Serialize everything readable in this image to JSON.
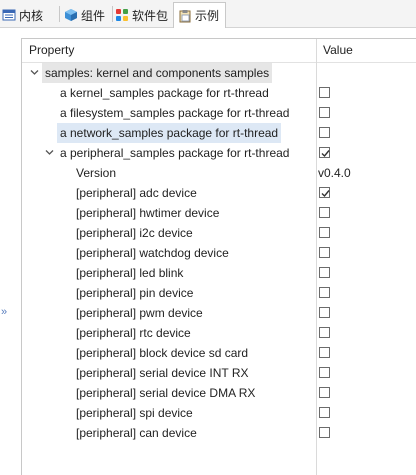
{
  "tabs": [
    {
      "label": "内核",
      "icon": "kernel-icon"
    },
    {
      "label": "组件",
      "icon": "cube-icon"
    },
    {
      "label": "软件包",
      "icon": "packages-icon"
    },
    {
      "label": "示例",
      "icon": "clipboard-icon",
      "active": true
    }
  ],
  "header": {
    "property": "Property",
    "value": "Value"
  },
  "tree": {
    "root": {
      "label": "samples: kernel and components samples"
    },
    "items": [
      {
        "label": "a kernel_samples package for rt-thread",
        "checked": false
      },
      {
        "label": "a filesystem_samples package for rt-thread",
        "checked": false
      },
      {
        "label": "a network_samples package for rt-thread",
        "checked": false
      },
      {
        "label": "a peripheral_samples package for rt-thread",
        "checked": true
      }
    ],
    "peripheral": {
      "version_label": "Version",
      "version_value": "v0.4.0",
      "children": [
        {
          "label": "[peripheral] adc device",
          "checked": true
        },
        {
          "label": "[peripheral] hwtimer device",
          "checked": false
        },
        {
          "label": "[peripheral] i2c device",
          "checked": false
        },
        {
          "label": "[peripheral] watchdog device",
          "checked": false
        },
        {
          "label": "[peripheral] led blink",
          "checked": false
        },
        {
          "label": "[peripheral] pin device",
          "checked": false
        },
        {
          "label": "[peripheral] pwm device",
          "checked": false
        },
        {
          "label": "[peripheral] rtc device",
          "checked": false
        },
        {
          "label": "[peripheral] block device sd card",
          "checked": false
        },
        {
          "label": "[peripheral] serial device INT RX",
          "checked": false
        },
        {
          "label": "[peripheral] serial device DMA RX",
          "checked": false
        },
        {
          "label": "[peripheral] spi device",
          "checked": false
        },
        {
          "label": "[peripheral] can device",
          "checked": false
        }
      ]
    }
  },
  "colors": {
    "root_highlight": "#e6e6e6",
    "selected_row": "#dde8f5",
    "check": "#333333"
  }
}
